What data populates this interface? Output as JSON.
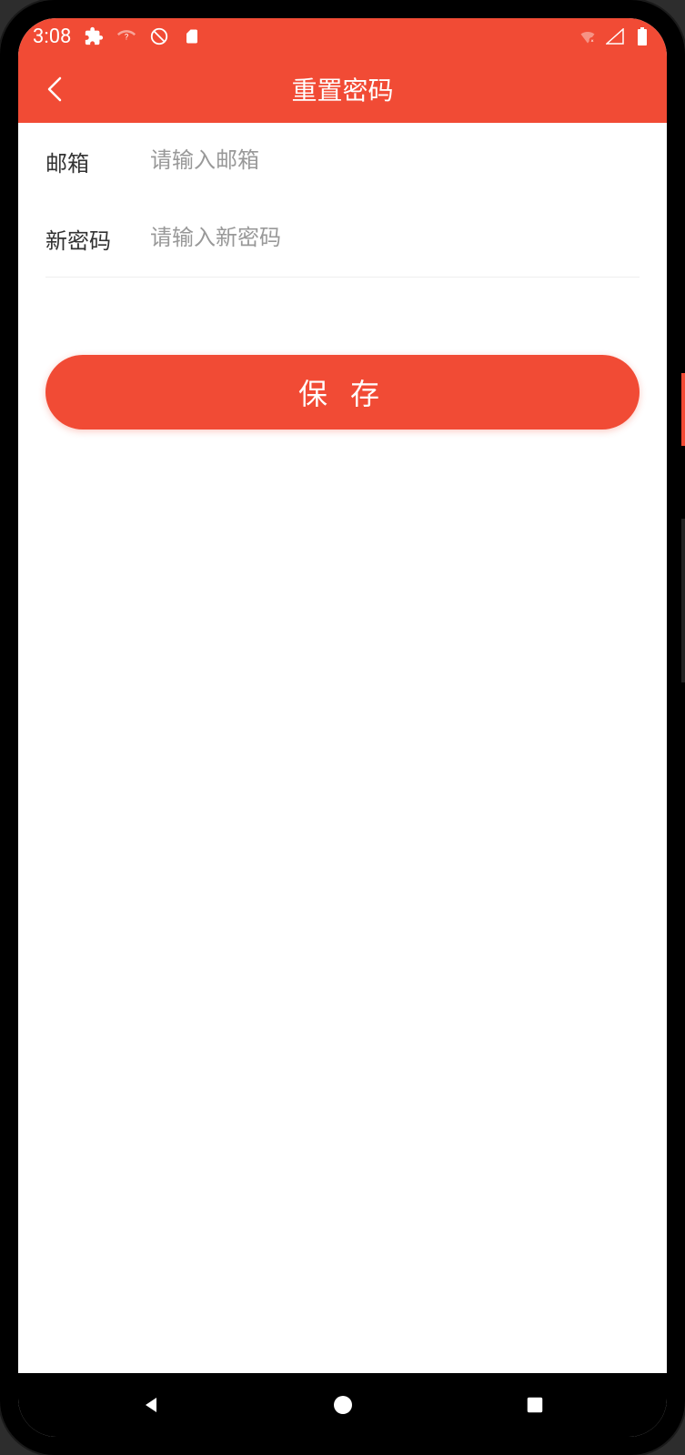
{
  "status_bar": {
    "time": "3:08"
  },
  "header": {
    "title": "重置密码"
  },
  "form": {
    "email_label": "邮箱",
    "email_placeholder": "请输入邮箱",
    "password_label": "新密码",
    "password_placeholder": "请输入新密码"
  },
  "buttons": {
    "save": "保 存"
  }
}
